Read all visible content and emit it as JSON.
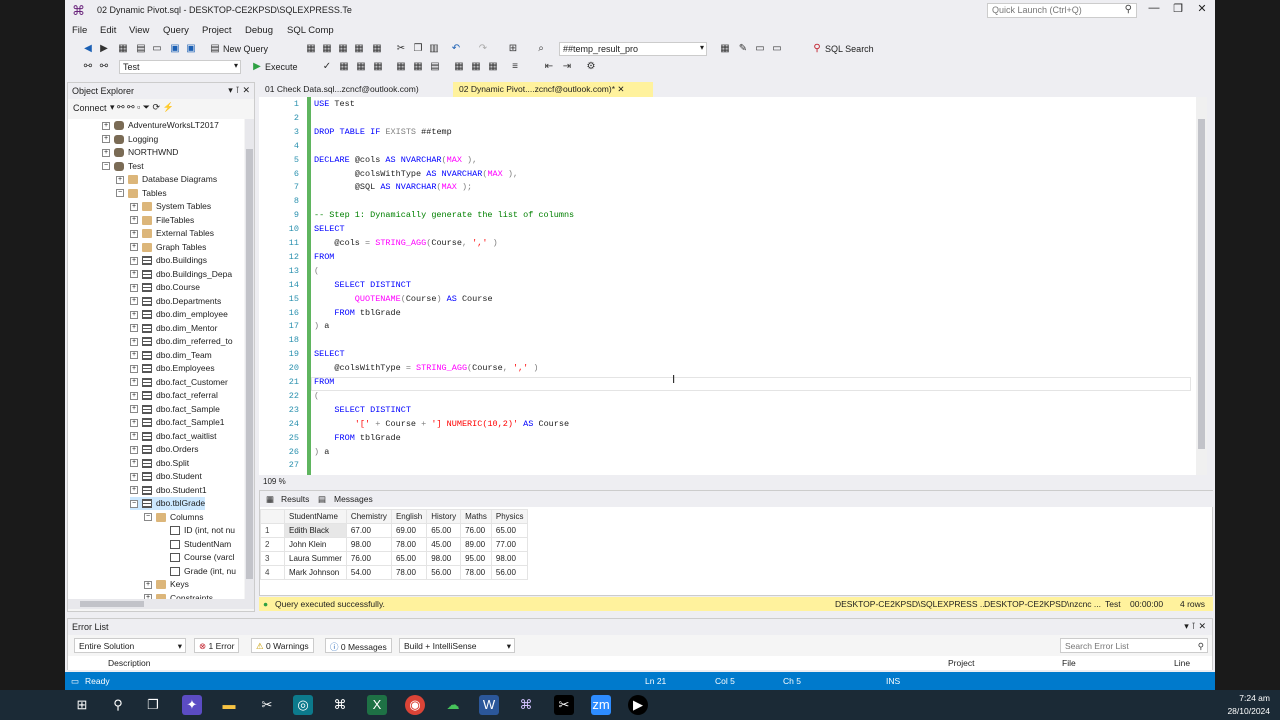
{
  "window": {
    "title": "02 Dynamic Pivot.sql - DESKTOP-CE2KPSD\\SQLEXPRESS.Te",
    "quick_launch_placeholder": "Quick Launch (Ctrl+Q)"
  },
  "menu": [
    "File",
    "Edit",
    "View",
    "Query",
    "Project",
    "Debug",
    "SQL Comp"
  ],
  "toolbar": {
    "new_query": "New Query",
    "target_combo": "##temp_result_pro",
    "sql_search": "SQL Search",
    "db_combo": "Test",
    "execute": "Execute"
  },
  "object_explorer": {
    "title": "Object Explorer",
    "connect": "Connect",
    "tree": [
      {
        "label": "AdventureWorksLT2017",
        "level": 2,
        "icon": "db",
        "exp": "+"
      },
      {
        "label": "Logging",
        "level": 2,
        "icon": "db",
        "exp": "+"
      },
      {
        "label": "NORTHWND",
        "level": 2,
        "icon": "db",
        "exp": "+"
      },
      {
        "label": "Test",
        "level": 2,
        "icon": "db",
        "exp": "-"
      },
      {
        "label": "Database Diagrams",
        "level": 3,
        "icon": "fld",
        "exp": "+"
      },
      {
        "label": "Tables",
        "level": 3,
        "icon": "fld",
        "exp": "-"
      },
      {
        "label": "System Tables",
        "level": 4,
        "icon": "fld",
        "exp": "+"
      },
      {
        "label": "FileTables",
        "level": 4,
        "icon": "fld",
        "exp": "+"
      },
      {
        "label": "External Tables",
        "level": 4,
        "icon": "fld",
        "exp": "+"
      },
      {
        "label": "Graph Tables",
        "level": 4,
        "icon": "fld",
        "exp": "+"
      },
      {
        "label": "dbo.Buildings",
        "level": 4,
        "icon": "tbl",
        "exp": "+"
      },
      {
        "label": "dbo.Buildings_Depa",
        "level": 4,
        "icon": "tbl",
        "exp": "+"
      },
      {
        "label": "dbo.Course",
        "level": 4,
        "icon": "tbl",
        "exp": "+"
      },
      {
        "label": "dbo.Departments",
        "level": 4,
        "icon": "tbl",
        "exp": "+"
      },
      {
        "label": "dbo.dim_employee",
        "level": 4,
        "icon": "tbl",
        "exp": "+"
      },
      {
        "label": "dbo.dim_Mentor",
        "level": 4,
        "icon": "tbl",
        "exp": "+"
      },
      {
        "label": "dbo.dim_referred_to",
        "level": 4,
        "icon": "tbl",
        "exp": "+"
      },
      {
        "label": "dbo.dim_Team",
        "level": 4,
        "icon": "tbl",
        "exp": "+"
      },
      {
        "label": "dbo.Employees",
        "level": 4,
        "icon": "tbl",
        "exp": "+"
      },
      {
        "label": "dbo.fact_Customer",
        "level": 4,
        "icon": "tbl",
        "exp": "+"
      },
      {
        "label": "dbo.fact_referral",
        "level": 4,
        "icon": "tbl",
        "exp": "+"
      },
      {
        "label": "dbo.fact_Sample",
        "level": 4,
        "icon": "tbl",
        "exp": "+"
      },
      {
        "label": "dbo.fact_Sample1",
        "level": 4,
        "icon": "tbl",
        "exp": "+"
      },
      {
        "label": "dbo.fact_waitlist",
        "level": 4,
        "icon": "tbl",
        "exp": "+"
      },
      {
        "label": "dbo.Orders",
        "level": 4,
        "icon": "tbl",
        "exp": "+"
      },
      {
        "label": "dbo.Split",
        "level": 4,
        "icon": "tbl",
        "exp": "+"
      },
      {
        "label": "dbo.Student",
        "level": 4,
        "icon": "tbl",
        "exp": "+"
      },
      {
        "label": "dbo.Student1",
        "level": 4,
        "icon": "tbl",
        "exp": "+"
      },
      {
        "label": "dbo.tblGrade",
        "level": 4,
        "icon": "tbl",
        "exp": "-"
      },
      {
        "label": "Columns",
        "level": 5,
        "icon": "fld",
        "exp": "-"
      },
      {
        "label": "ID (int, not nu",
        "level": 6,
        "icon": "col",
        "exp": ""
      },
      {
        "label": "StudentNam",
        "level": 6,
        "icon": "col",
        "exp": ""
      },
      {
        "label": "Course (varcl",
        "level": 6,
        "icon": "col",
        "exp": ""
      },
      {
        "label": "Grade (int, nu",
        "level": 6,
        "icon": "col",
        "exp": ""
      },
      {
        "label": "Keys",
        "level": 5,
        "icon": "fld",
        "exp": "+"
      },
      {
        "label": "Constraints",
        "level": 5,
        "icon": "fld",
        "exp": "+"
      }
    ]
  },
  "editor": {
    "tab_inactive": "01 Check Data.sql...zcncf@outlook.com)",
    "tab_active": "02 Dynamic Pivot....zcncf@outlook.com)*",
    "zoom": "109 %",
    "lines": [
      [
        [
          "k",
          "USE "
        ],
        [
          "",
          "Test"
        ]
      ],
      [],
      [
        [
          "k",
          "DROP TABLE IF "
        ],
        [
          "g",
          "EXISTS "
        ],
        [
          "",
          "##temp"
        ]
      ],
      [],
      [
        [
          "k",
          "DECLARE "
        ],
        [
          "",
          "@cols "
        ],
        [
          "k",
          "AS NVARCHAR"
        ],
        [
          "g",
          "("
        ],
        [
          "f",
          "MAX"
        ],
        [
          "g",
          " ),"
        ]
      ],
      [
        [
          "",
          "        @colsWithType "
        ],
        [
          "k",
          "AS NVARCHAR"
        ],
        [
          "g",
          "("
        ],
        [
          "f",
          "MAX"
        ],
        [
          "g",
          " ),"
        ]
      ],
      [
        [
          "",
          "        @SQL "
        ],
        [
          "k",
          "AS NVARCHAR"
        ],
        [
          "g",
          "("
        ],
        [
          "f",
          "MAX"
        ],
        [
          "g",
          " );"
        ]
      ],
      [],
      [
        [
          "c",
          "-- Step 1: Dynamically generate the list of columns"
        ]
      ],
      [
        [
          "k",
          "SELECT"
        ]
      ],
      [
        [
          "",
          "    @cols "
        ],
        [
          "g",
          "= "
        ],
        [
          "f",
          "STRING_AGG"
        ],
        [
          "g",
          "("
        ],
        [
          "",
          "Course"
        ],
        [
          "g",
          ", "
        ],
        [
          "s",
          "','"
        ],
        [
          "g",
          " )"
        ]
      ],
      [
        [
          "k",
          "FROM"
        ]
      ],
      [
        [
          "g",
          "("
        ]
      ],
      [
        [
          "k",
          "    SELECT DISTINCT"
        ]
      ],
      [
        [
          "f",
          "        QUOTENAME"
        ],
        [
          "g",
          "("
        ],
        [
          "",
          "Course"
        ],
        [
          "g",
          ")"
        ],
        [
          "k",
          " AS "
        ],
        [
          "",
          "Course"
        ]
      ],
      [
        [
          "k",
          "    FROM "
        ],
        [
          "",
          "tblGrade"
        ]
      ],
      [
        [
          "g",
          ") "
        ],
        [
          "",
          "a"
        ]
      ],
      [],
      [
        [
          "k",
          "SELECT"
        ]
      ],
      [
        [
          "",
          "    @colsWithType "
        ],
        [
          "g",
          "= "
        ],
        [
          "f",
          "STRING_AGG"
        ],
        [
          "g",
          "("
        ],
        [
          "",
          "Course"
        ],
        [
          "g",
          ", "
        ],
        [
          "s",
          "','"
        ],
        [
          "g",
          " )"
        ]
      ],
      [
        [
          "k",
          "FROM"
        ]
      ],
      [
        [
          "g",
          "("
        ]
      ],
      [
        [
          "k",
          "    SELECT DISTINCT"
        ]
      ],
      [
        [
          "s",
          "        '['"
        ],
        [
          "g",
          " + "
        ],
        [
          "",
          "Course "
        ],
        [
          "g",
          "+ "
        ],
        [
          "s",
          "'] NUMERIC(10,2)'"
        ],
        [
          "k",
          " AS "
        ],
        [
          "",
          "Course"
        ]
      ],
      [
        [
          "k",
          "    FROM "
        ],
        [
          "",
          "tblGrade"
        ]
      ],
      [
        [
          "g",
          ") "
        ],
        [
          "",
          "a"
        ]
      ],
      []
    ]
  },
  "results": {
    "tab_results": "Results",
    "tab_messages": "Messages",
    "columns": [
      "StudentName",
      "Chemistry",
      "English",
      "History",
      "Maths",
      "Physics"
    ],
    "rows": [
      [
        "1",
        "Edith Black",
        "67.00",
        "69.00",
        "65.00",
        "76.00",
        "65.00"
      ],
      [
        "2",
        "John Klein",
        "98.00",
        "78.00",
        "45.00",
        "89.00",
        "77.00"
      ],
      [
        "3",
        "Laura Summer",
        "76.00",
        "65.00",
        "98.00",
        "95.00",
        "98.00"
      ],
      [
        "4",
        "Mark Johnson",
        "54.00",
        "78.00",
        "56.00",
        "78.00",
        "56.00"
      ]
    ]
  },
  "query_status": {
    "message": "Query executed successfully.",
    "server": "DESKTOP-CE2KPSD\\SQLEXPRESS ...",
    "user": "DESKTOP-CE2KPSD\\nzcnc ...",
    "db": "Test",
    "time": "00:00:00",
    "rows": "4 rows"
  },
  "error_list": {
    "title": "Error List",
    "scope": "Entire Solution",
    "errors": "1 Error",
    "warnings": "0 Warnings",
    "messages": "0 Messages",
    "build": "Build + IntelliSense",
    "search_placeholder": "Search Error List",
    "col_description": "Description",
    "col_project": "Project",
    "col_file": "File",
    "col_line": "Line"
  },
  "vs_status": {
    "ready": "Ready",
    "ln": "Ln 21",
    "col": "Col 5",
    "ch": "Ch 5",
    "ins": "INS"
  },
  "clock": {
    "time": "7:24 am",
    "date": "28/10/2024"
  }
}
